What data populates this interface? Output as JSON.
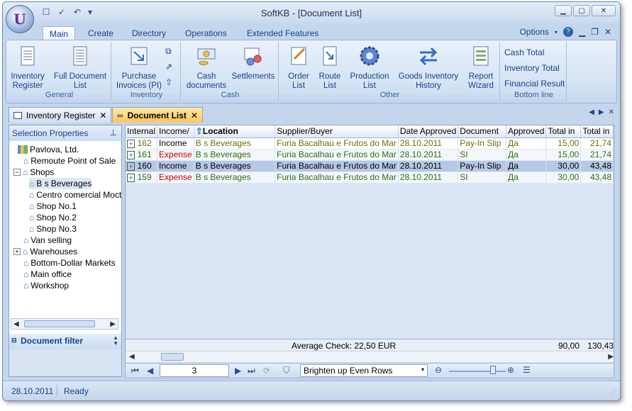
{
  "window": {
    "title": "SoftKB - [Document List]"
  },
  "ribbon_tabs": [
    "Main",
    "Create",
    "Directory",
    "Operations",
    "Extended Features"
  ],
  "options_label": "Options",
  "help_label": "?",
  "groups": {
    "general": {
      "label": "General",
      "buttons": [
        {
          "label": "Inventory Register"
        },
        {
          "label": "Full Document List"
        }
      ]
    },
    "inventory": {
      "label": "Inventory",
      "buttons": [
        {
          "label": "Purchase Invoices (PI)"
        }
      ]
    },
    "cash": {
      "label": "Cash",
      "buttons": [
        {
          "label": "Cash documents"
        },
        {
          "label": "Settlements"
        }
      ]
    },
    "other": {
      "label": "Other",
      "buttons": [
        {
          "label": "Order List"
        },
        {
          "label": "Route List"
        },
        {
          "label": "Production List"
        },
        {
          "label": "Goods Inventory History"
        },
        {
          "label": "Report Wizard"
        }
      ]
    },
    "bottom_line": {
      "label": "Bottom line",
      "items": [
        "Cash Total",
        "Inventory Total",
        "Financial Result"
      ]
    }
  },
  "doc_tabs": [
    {
      "label": "Inventory Register"
    },
    {
      "label": "Document List"
    }
  ],
  "left_panel": {
    "title": "Selection Properties",
    "tree": [
      "Pavlova, Ltd.",
      "Remoute Point of Sale",
      "Shops",
      "B s Beverages",
      "Centro comercial Moctez",
      "Shop No.1",
      "Shop No.2",
      "Shop No.3",
      "Van selling",
      "Warehouses",
      "Bottom-Dollar Markets",
      "Main office",
      "Workshop"
    ],
    "filter_title": "Document filter"
  },
  "grid": {
    "columns": [
      "Internal",
      "Income/",
      "Location",
      "Supplier/Buyer",
      "Date Approved",
      "Document",
      "Approved",
      "Total in",
      "Total in"
    ],
    "rows": [
      {
        "internal": "162",
        "type": "Income",
        "location": "B s Beverages",
        "supplier": "Furia Bacalhau e Frutos do Mar",
        "date": "28.10.2011",
        "document": "Pay-In Slip",
        "approved": "Да",
        "total1": "15,00",
        "total2": "21,74"
      },
      {
        "internal": "161",
        "type": "Expense",
        "location": "B s Beverages",
        "supplier": "Furia Bacalhau e Frutos do Mar",
        "date": "28.10.2011",
        "document": "SI",
        "approved": "Да",
        "total1": "15,00",
        "total2": "21,74"
      },
      {
        "internal": "160",
        "type": "Income",
        "location": "B s Beverages",
        "supplier": "Furia Bacalhau e Frutos do Mar",
        "date": "28.10.2011",
        "document": "Pay-In Slip",
        "approved": "Да",
        "total1": "30,00",
        "total2": "43,48"
      },
      {
        "internal": "159",
        "type": "Expense",
        "location": "B s Beverages",
        "supplier": "Furia Bacalhau e Frutos do Mar",
        "date": "28.10.2011",
        "document": "SI",
        "approved": "Да",
        "total1": "30,00",
        "total2": "43,48"
      }
    ],
    "footer": {
      "average": "Average Check: 22,50 EUR",
      "sum1": "90,00",
      "sum2": "130,43"
    }
  },
  "navigator": {
    "page": "3",
    "style_option": "Brighten up Even Rows"
  },
  "status": {
    "date": "28.10.2011",
    "state": "Ready"
  }
}
